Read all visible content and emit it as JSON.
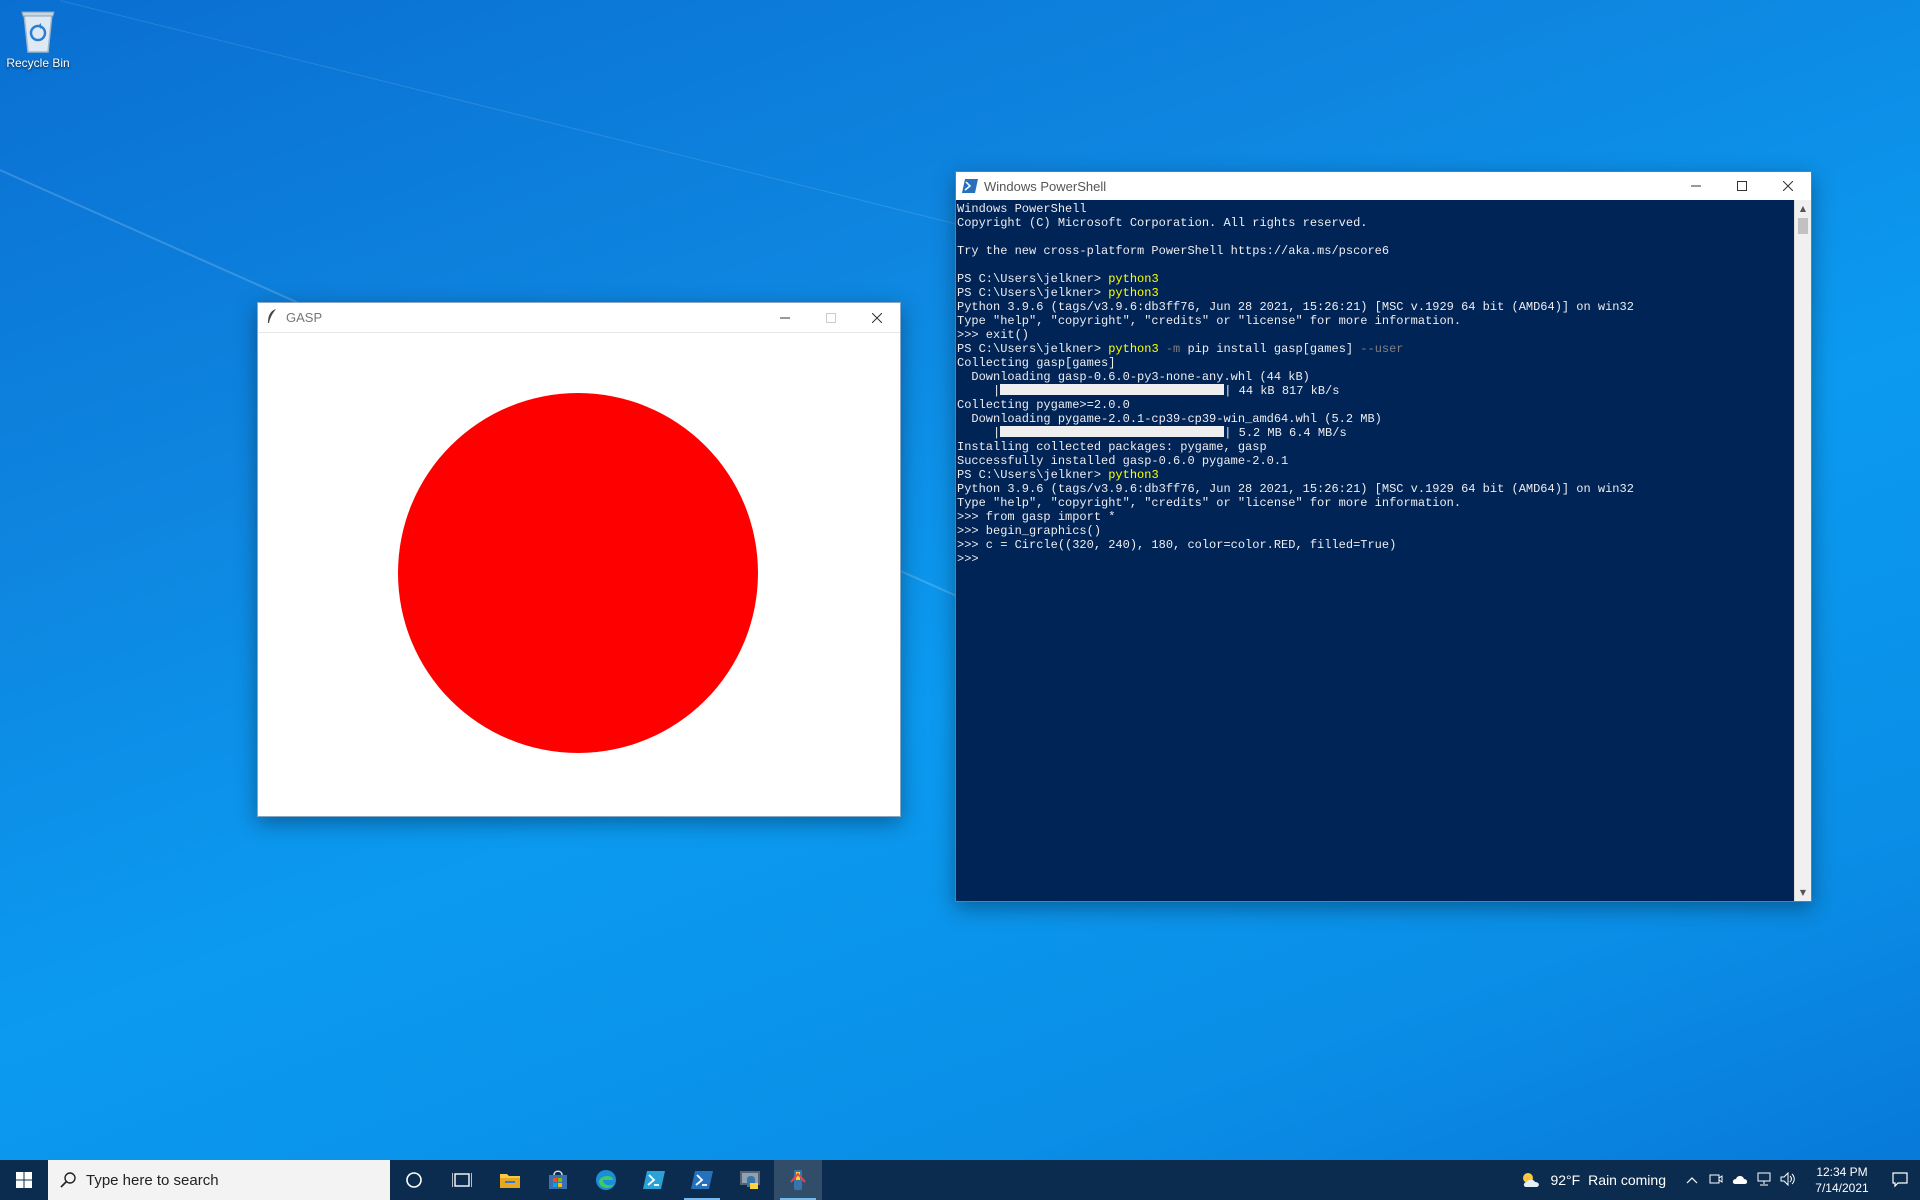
{
  "desktop": {
    "recycle_bin_label": "Recycle Bin"
  },
  "gasp_window": {
    "title": "GASP",
    "circle_color": "#ff0000"
  },
  "powershell_window": {
    "title": "Windows PowerShell",
    "background_color": "#012456",
    "lines": [
      [
        {
          "t": "Windows PowerShell"
        }
      ],
      [
        {
          "t": "Copyright (C) Microsoft Corporation. All rights reserved."
        }
      ],
      [
        {
          "t": ""
        }
      ],
      [
        {
          "t": "Try the new cross-platform PowerShell https://aka.ms/pscore6"
        }
      ],
      [
        {
          "t": ""
        }
      ],
      [
        {
          "t": "PS C:\\Users\\jelkner> "
        },
        {
          "t": "python3",
          "c": "cmd"
        }
      ],
      [
        {
          "t": "PS C:\\Users\\jelkner> "
        },
        {
          "t": "python3",
          "c": "cmd"
        }
      ],
      [
        {
          "t": "Python 3.9.6 (tags/v3.9.6:db3ff76, Jun 28 2021, 15:26:21) [MSC v.1929 64 bit (AMD64)] on win32"
        }
      ],
      [
        {
          "t": "Type \"help\", \"copyright\", \"credits\" or \"license\" for more information."
        }
      ],
      [
        {
          "t": ">>> exit()"
        }
      ],
      [
        {
          "t": "PS C:\\Users\\jelkner> "
        },
        {
          "t": "python3",
          "c": "cmd"
        },
        {
          "t": " -m",
          "c": "param"
        },
        {
          "t": " pip install gasp[games] "
        },
        {
          "t": "--user",
          "c": "param"
        }
      ],
      [
        {
          "t": "Collecting gasp[games]"
        }
      ],
      [
        {
          "t": "  Downloading gasp-0.6.0-py3-none-any.whl (44 kB)"
        }
      ],
      [
        {
          "t": "     |"
        },
        {
          "bar": true
        },
        {
          "t": "| 44 kB 817 kB/s"
        }
      ],
      [
        {
          "t": "Collecting pygame>=2.0.0"
        }
      ],
      [
        {
          "t": "  Downloading pygame-2.0.1-cp39-cp39-win_amd64.whl (5.2 MB)"
        }
      ],
      [
        {
          "t": "     |"
        },
        {
          "bar": true
        },
        {
          "t": "| 5.2 MB 6.4 MB/s"
        }
      ],
      [
        {
          "t": "Installing collected packages: pygame, gasp"
        }
      ],
      [
        {
          "t": "Successfully installed gasp-0.6.0 pygame-2.0.1"
        }
      ],
      [
        {
          "t": "PS C:\\Users\\jelkner> "
        },
        {
          "t": "python3",
          "c": "cmd"
        }
      ],
      [
        {
          "t": "Python 3.9.6 (tags/v3.9.6:db3ff76, Jun 28 2021, 15:26:21) [MSC v.1929 64 bit (AMD64)] on win32"
        }
      ],
      [
        {
          "t": "Type \"help\", \"copyright\", \"credits\" or \"license\" for more information."
        }
      ],
      [
        {
          "t": ">>> from gasp import *"
        }
      ],
      [
        {
          "t": ">>> begin_graphics()"
        }
      ],
      [
        {
          "t": ">>> c = Circle((320, 240), 180, color=color.RED, filled=True)"
        }
      ],
      [
        {
          "t": ">>> "
        }
      ]
    ]
  },
  "taskbar": {
    "search_placeholder": "Type here to search",
    "apps": [
      "cortana-icon",
      "task-view-icon",
      "file-explorer-icon",
      "store-icon",
      "edge-icon",
      "terminal-icon",
      "powershell-icon",
      "python-icon",
      "python-idle-icon"
    ],
    "weather_temp": "92°F",
    "weather_text": "Rain coming",
    "time": "12:34 PM",
    "date": "7/14/2021"
  }
}
